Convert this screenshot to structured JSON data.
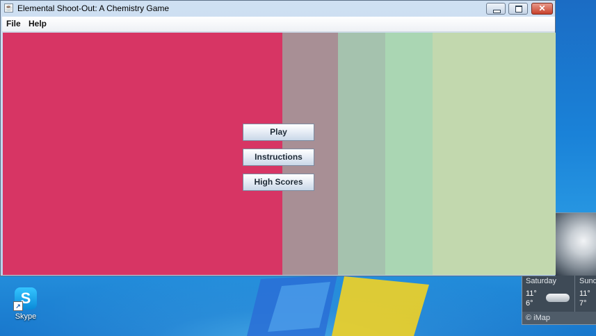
{
  "window": {
    "title": "Elemental Shoot-Out: A Chemistry Game",
    "controls": {
      "minimize": "minimize",
      "maximize": "maximize",
      "close": "close"
    }
  },
  "menubar": {
    "items": [
      {
        "label": "File"
      },
      {
        "label": "Help"
      }
    ]
  },
  "main_menu": {
    "buttons": [
      {
        "label": "Play"
      },
      {
        "label": "Instructions"
      },
      {
        "label": "High Scores"
      }
    ]
  },
  "background_stripes": [
    "#d73564",
    "#a88f95",
    "#a5c2ae",
    "#aad6b3",
    "#c2d8ae"
  ],
  "desktop": {
    "icons": [
      {
        "label": "Skype",
        "icon": "skype-icon"
      }
    ]
  },
  "weather_gadget": {
    "days": [
      {
        "day": "Saturday",
        "high": "11°",
        "low": "6°"
      },
      {
        "day": "Sund",
        "high": "11°",
        "low": "7°"
      }
    ],
    "source": "© iMap"
  }
}
